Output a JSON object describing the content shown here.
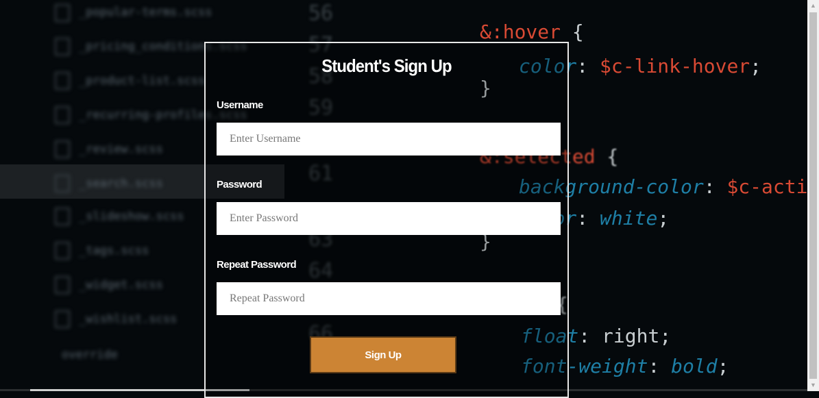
{
  "form": {
    "title": "Student's Sign Up",
    "username_label": "Username",
    "username_placeholder": "Enter Username",
    "password_label": "Password",
    "password_placeholder": "Enter Password",
    "repeat_label": "Repeat Password",
    "repeat_placeholder": "Repeat Password",
    "submit_label": "Sign Up"
  },
  "background": {
    "files": [
      "_popular-terms.scss",
      "_pricing_conditions.scss",
      "_product-list.scss",
      "_recurring-profiles.scss",
      "_review.scss",
      "_search.scss",
      "_slideshow.scss",
      "_tags.scss",
      "_widget.scss",
      "_wishlist.scss",
      "override"
    ],
    "line_numbers": [
      "56",
      "57",
      "58",
      "59",
      "61",
      "63",
      "64",
      "66"
    ],
    "code": {
      "l1_sel": "&:hover",
      "l1_brace": " {",
      "l2_prop": "color",
      "l2_colon": ": ",
      "l2_val": "$c-link-hover",
      "l2_semi": ";",
      "l3": "}",
      "l4_sel": "&:selected",
      "l4_brace": " {",
      "l5_prop": "background-color",
      "l5_colon": ": ",
      "l5_val": "$c-action",
      "l5_semi": ";",
      "l6_prop": "color",
      "l6_colon": ": ",
      "l6_val": "white",
      "l6_semi": ";",
      "l7": "}",
      "l8": "{",
      "l9_prop": "float",
      "l9_colon": ": ",
      "l9_val": "right",
      "l9_semi": ";",
      "l10_prop": "font-weight",
      "l10_colon": ": ",
      "l10_val": "bold",
      "l10_semi": ";"
    }
  },
  "colors": {
    "button": "#cc8434",
    "background": "#05090c"
  }
}
